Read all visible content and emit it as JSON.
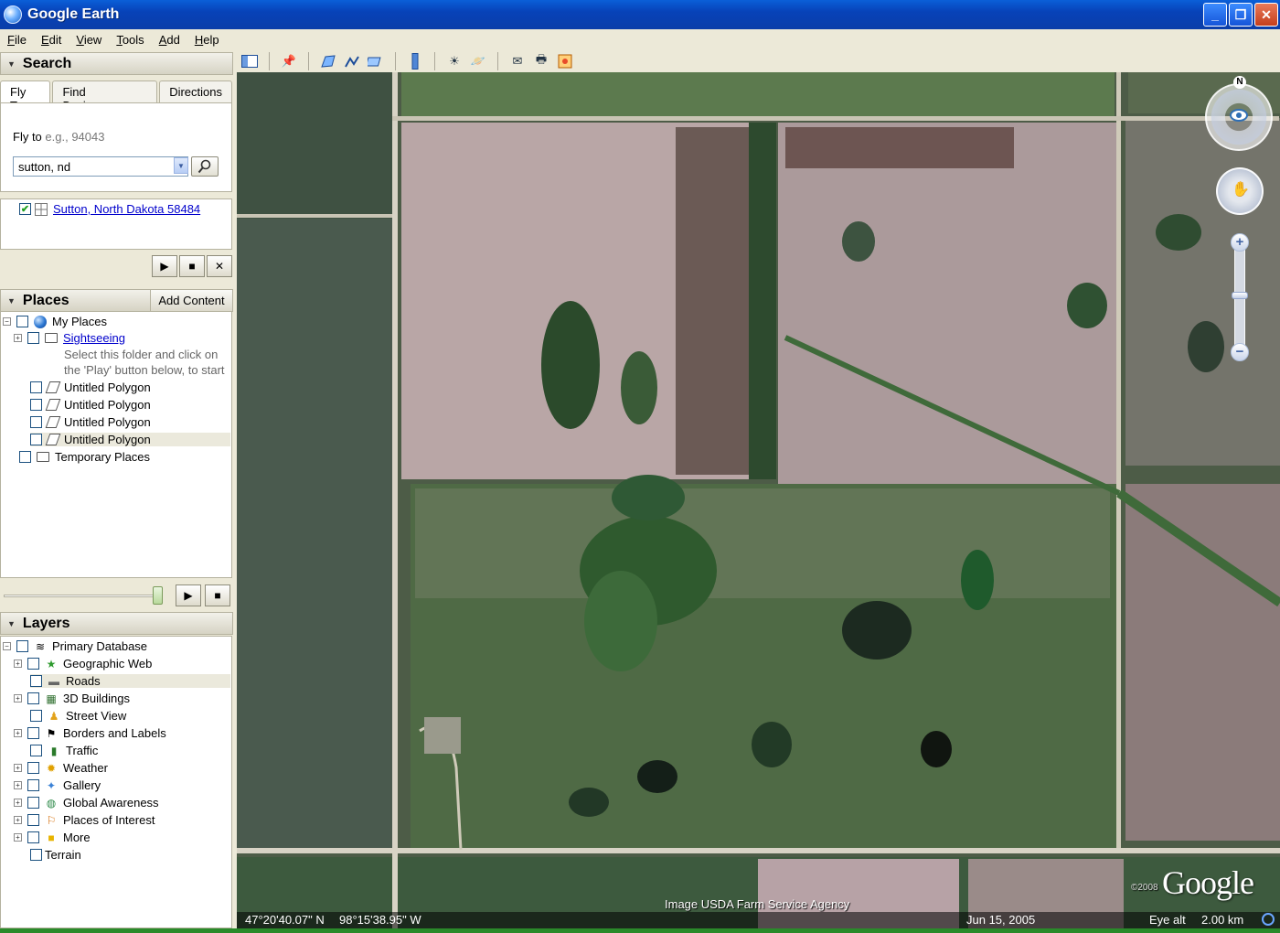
{
  "window": {
    "title": "Google Earth",
    "controls": [
      "_",
      "❐",
      "✕"
    ]
  },
  "menu": [
    {
      "label": "File",
      "key": "F",
      "rest": "ile"
    },
    {
      "label": "Edit",
      "key": "E",
      "rest": "dit"
    },
    {
      "label": "View",
      "key": "V",
      "rest": "iew"
    },
    {
      "label": "Tools",
      "key": "T",
      "rest": "ools"
    },
    {
      "label": "Add",
      "key": "A",
      "rest": "dd"
    },
    {
      "label": "Help",
      "key": "H",
      "rest": "elp"
    }
  ],
  "search": {
    "header": "Search",
    "tabs": [
      "Fly To",
      "Find Businesses",
      "Directions"
    ],
    "fly_label": "Fly to",
    "fly_hint": "e.g., 94043",
    "query": "sutton, nd",
    "result": "Sutton, North Dakota 58484"
  },
  "places": {
    "header": "Places",
    "add_content": "Add Content",
    "items": {
      "my_places": "My Places",
      "sightseeing": "Sightseeing",
      "desc_line1": "Select this folder and click on",
      "desc_line2": "the 'Play' button below, to start",
      "poly1": "Untitled Polygon",
      "poly2": "Untitled Polygon",
      "poly3": "Untitled Polygon",
      "poly4": "Untitled Polygon",
      "temporary": "Temporary Places"
    }
  },
  "layers": {
    "header": "Layers",
    "items": {
      "primary": "Primary Database",
      "geoweb": "Geographic Web",
      "roads": "Roads",
      "buildings": "3D Buildings",
      "streetview": "Street View",
      "borders": "Borders and Labels",
      "traffic": "Traffic",
      "weather": "Weather",
      "gallery": "Gallery",
      "global": "Global Awareness",
      "poi": "Places of Interest",
      "more": "More",
      "terrain": "Terrain"
    }
  },
  "map": {
    "north": "N",
    "imagery_credit": "Image USDA Farm Service Agency",
    "copyright": "©2008",
    "logo": "Google",
    "latitude": "47°20'40.07\" N",
    "longitude": "98°15'38.95\" W",
    "date": "Jun 15, 2005",
    "eye_alt_label": "Eye alt",
    "eye_alt_value": "2.00 km"
  }
}
